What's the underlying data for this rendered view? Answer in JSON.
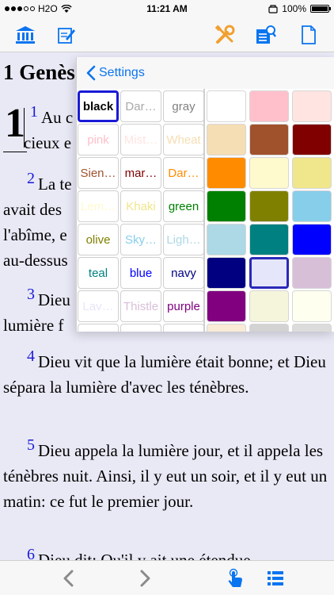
{
  "status_bar": {
    "carrier": "H2O",
    "time": "11:21 AM",
    "battery": "100%"
  },
  "toolbar": {
    "icons": [
      "library-icon",
      "edit-notes-icon",
      "tools-icon",
      "search-book-icon",
      "document-icon"
    ]
  },
  "reader": {
    "chapter_title": "1 Genès",
    "chapter_number": "1",
    "verses": [
      {
        "number": "1",
        "lines": [
          "Au c",
          "cieux e"
        ]
      },
      {
        "number": "2",
        "lines": [
          "La te",
          "avait des",
          "l'abîme, e",
          "au-dessus"
        ]
      },
      {
        "number": "3",
        "lines": [
          "Dieu",
          "lumière f"
        ]
      },
      {
        "number": "4",
        "text": "Dieu vit que la lumière était bonne; et Dieu sépara la lumière d'avec les ténèbres."
      },
      {
        "number": "5",
        "text": "Dieu appela la lumière jour, et il appela les ténèbres nuit. Ainsi, il y eut un soir, et il y eut un matin: ce fut le premier jour."
      },
      {
        "number": "6",
        "text": "Dieu dit: Qu'il y ait une étendue"
      }
    ]
  },
  "popover": {
    "back_label": "Settings",
    "color_names": [
      [
        "black",
        "Dar…",
        "gray"
      ],
      [
        "pink",
        "Mist…",
        "Wheat"
      ],
      [
        "Sien…",
        "mar…",
        "Dar…"
      ],
      [
        "Lem…",
        "Khaki",
        "green"
      ],
      [
        "olive",
        "Sky…",
        "Ligh…"
      ],
      [
        "teal",
        "blue",
        "navy"
      ],
      [
        "Lav…",
        "Thistle",
        "purple"
      ],
      [
        "",
        "",
        ""
      ]
    ],
    "name_colors": [
      [
        "#000000",
        "#a9a9a9",
        "#808080"
      ],
      [
        "#ffc0cb",
        "#ffe4e1",
        "#f5deb3"
      ],
      [
        "#a0522d",
        "#800000",
        "#ff8c00"
      ],
      [
        "#fffacd",
        "#f0e68c",
        "#008000"
      ],
      [
        "#808000",
        "#87ceeb",
        "#add8e6"
      ],
      [
        "#008080",
        "#0000ff",
        "#000080"
      ],
      [
        "#e6e6fa",
        "#d8bfd8",
        "#800080"
      ],
      [
        "#ffffff",
        "#ffffff",
        "#ffffff"
      ]
    ],
    "selected_name": "black",
    "swatches": [
      [
        "#ffffff",
        "#ffc0cb",
        "#ffe4e1"
      ],
      [
        "#f5deb3",
        "#a0522d",
        "#800000"
      ],
      [
        "#ff8c00",
        "#fffacd",
        "#f0e68c"
      ],
      [
        "#008000",
        "#808000",
        "#87ceeb"
      ],
      [
        "#add8e6",
        "#008080",
        "#0000ff"
      ],
      [
        "#000080",
        "#e6e6fa",
        "#d8bfd8"
      ],
      [
        "#800080",
        "#f5f5dc",
        "#fffff0"
      ],
      [
        "#faebd7",
        "#d3d3d3",
        "#dcdcdc"
      ]
    ],
    "selected_swatch": "#e6e6fa"
  },
  "bottom_bar": {
    "icons": [
      "chevron-left-icon",
      "chevron-right-icon",
      "tap-icon",
      "list-icon"
    ]
  },
  "colors": {
    "accent": "#0a74f0",
    "verse_number": "#1a1ad6",
    "page_bg": "#e9e9f6"
  }
}
